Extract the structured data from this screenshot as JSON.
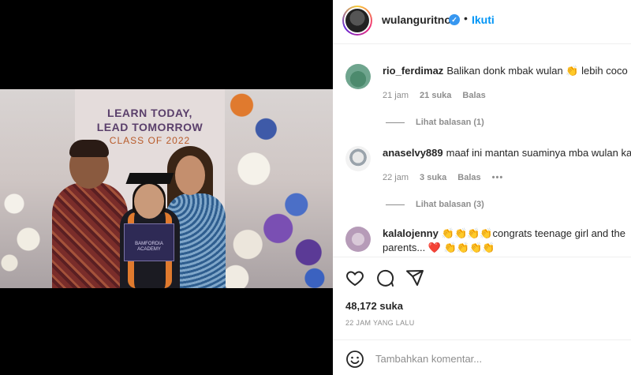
{
  "post": {
    "banner": [
      "LEARN TODAY,",
      "LEAD TOMORROW",
      "CLASS OF 2022"
    ],
    "diploma_text": "BAMFORDIA ACADEMY"
  },
  "header": {
    "username": "wulanguritno",
    "separator": "•",
    "follow_label": "Ikuti"
  },
  "comments": [
    {
      "username": "rio_ferdimaz",
      "text": "Balikan donk mbak wulan 👏 lebih coco",
      "time": "21 jam",
      "likes": "21 suka",
      "reply_label": "Balas",
      "view_replies": "Lihat balasan (1)"
    },
    {
      "username": "anaselvy889",
      "text": "maaf ini mantan suaminya mba wulan ka",
      "time": "22 jam",
      "likes": "3 suka",
      "reply_label": "Balas",
      "more": "•••",
      "view_replies": "Lihat balasan (3)"
    },
    {
      "username": "kalalojenny",
      "text": "👏👏👏👏congrats teenage girl and the",
      "text2": "parents... ❤️ 👏👏👏👏"
    }
  ],
  "actions": {
    "likes": "48,172 suka",
    "time_ago": "22 JAM YANG LALU"
  },
  "add_comment": {
    "placeholder": "Tambahkan komentar..."
  },
  "colors": {
    "accent": "#0095f6",
    "verified": "#3797f0",
    "muted": "#8e8e8e"
  }
}
